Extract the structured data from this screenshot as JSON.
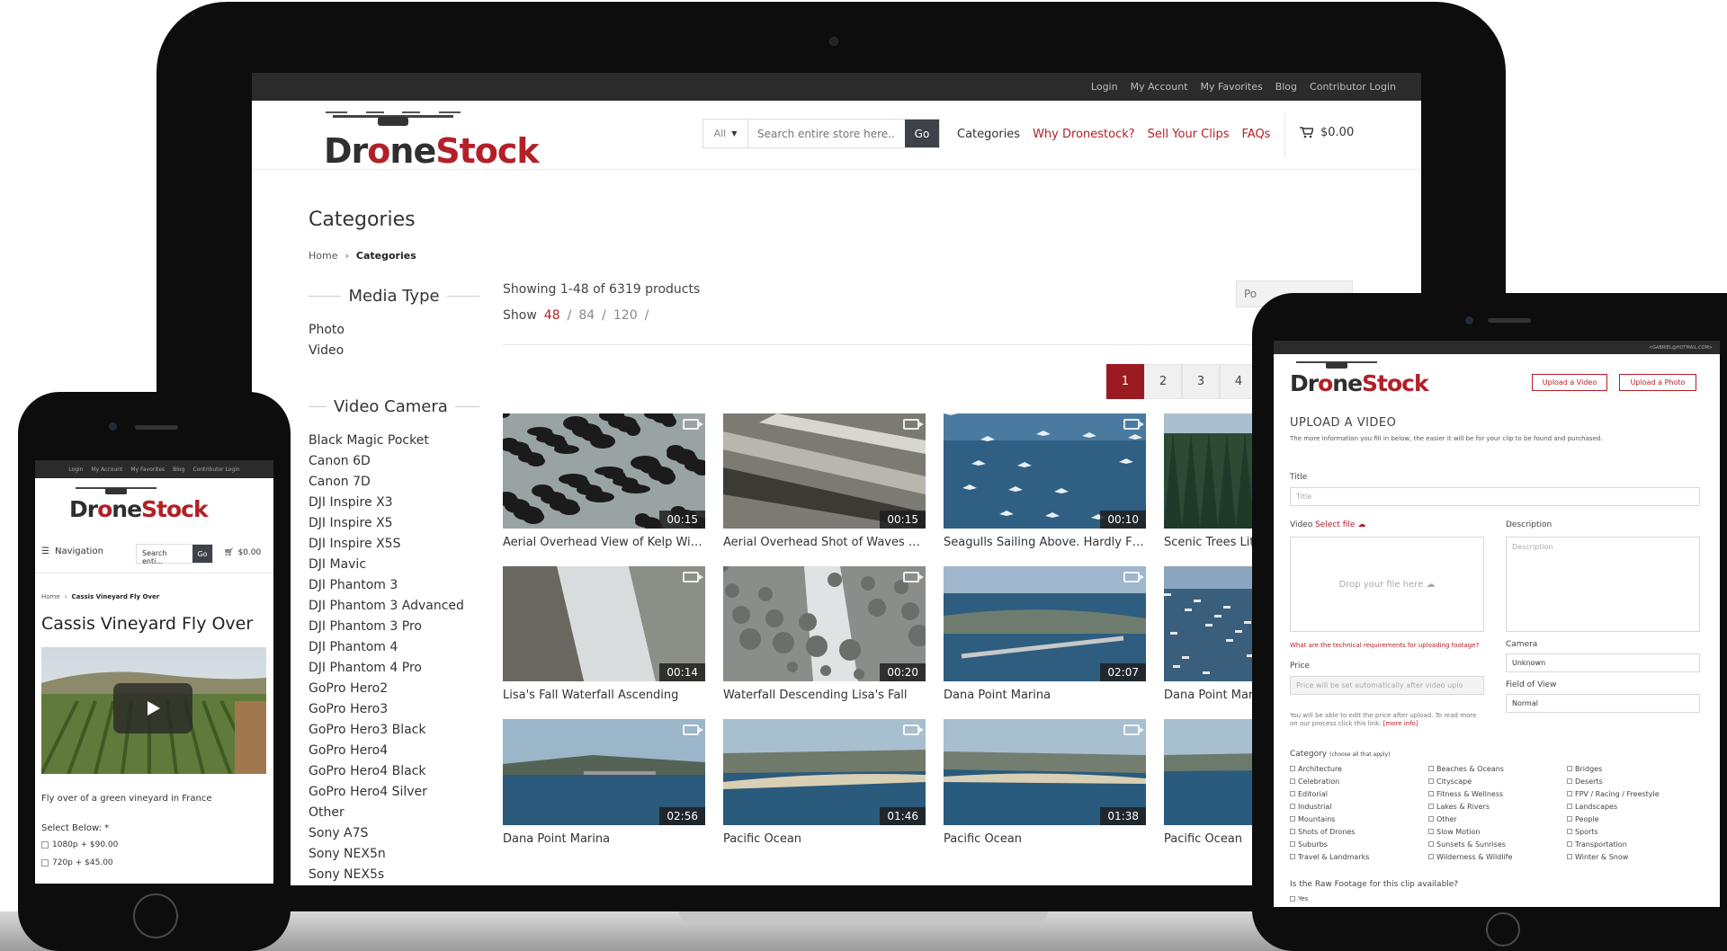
{
  "laptop": {
    "util_links": [
      "Login",
      "My Account",
      "My Favorites",
      "Blog",
      "Contributor Login"
    ],
    "logo": {
      "part1": "Dr",
      "part2": "ne",
      "part3": "Stock"
    },
    "search": {
      "category": "All",
      "placeholder": "Search entire store here...",
      "go": "Go"
    },
    "nav": [
      "Categories",
      "Why Dronestock?",
      "Sell Your Clips",
      "FAQs"
    ],
    "cart_total": "$0.00",
    "page_title": "Categories",
    "breadcrumb": {
      "home": "Home",
      "current": "Categories"
    },
    "sidebar": {
      "media_type_heading": "Media Type",
      "media_types": [
        "Photo",
        "Video"
      ],
      "camera_heading": "Video Camera",
      "cameras": [
        "Black Magic Pocket",
        "Canon 6D",
        "Canon 7D",
        "DJI Inspire X3",
        "DJI Inspire X5",
        "DJI Inspire X5S",
        "DJI Mavic",
        "DJI Phantom 3",
        "DJI Phantom 3 Advanced",
        "DJI Phantom 3 Pro",
        "DJI Phantom 4",
        "DJI Phantom 4 Pro",
        "GoPro Hero2",
        "GoPro Hero3",
        "GoPro Hero3 Black",
        "GoPro Hero4",
        "GoPro Hero4 Black",
        "GoPro Hero4 Silver",
        "Other",
        "Sony A7S",
        "Sony NEX5n",
        "Sony NEX5s"
      ]
    },
    "toolbar": {
      "count": "Showing 1-48 of 6319 products",
      "show_label": "Show",
      "show_options": [
        "48",
        "84",
        "120"
      ],
      "sort": "Po"
    },
    "pager": [
      "1",
      "2",
      "3",
      "4"
    ],
    "products": [
      {
        "title": "Aerial Overhead View of Kelp With ...",
        "duration": "00:15"
      },
      {
        "title": "Aerial Overhead Shot of Waves Rol...",
        "duration": "00:15"
      },
      {
        "title": "Seagulls Sailing Above. Hardly Fla...",
        "duration": "00:10"
      },
      {
        "title": "Scenic Trees Lit",
        "duration": ""
      },
      {
        "title": "Lisa's Fall Waterfall Ascending",
        "duration": "00:14"
      },
      {
        "title": "Waterfall Descending Lisa's Fall",
        "duration": "00:20"
      },
      {
        "title": "Dana Point Marina",
        "duration": "02:07"
      },
      {
        "title": "Dana Point Mari",
        "duration": ""
      },
      {
        "title": "Dana Point Marina",
        "duration": "02:56"
      },
      {
        "title": "Pacific Ocean",
        "duration": "01:46"
      },
      {
        "title": "Pacific Ocean",
        "duration": "01:38"
      },
      {
        "title": "Pacific Ocean",
        "duration": ""
      }
    ]
  },
  "phone": {
    "util_links": [
      "Login",
      "My Account",
      "My Favorites",
      "Blog",
      "Contributor Login"
    ],
    "nav_label": "Navigation",
    "search_placeholder": "Search enti...",
    "go": "Go",
    "cart_total": "$0.00",
    "breadcrumb": {
      "home": "Home",
      "current": "Cassis Vineyard Fly Over"
    },
    "title": "Cassis Vineyard Fly Over",
    "description": "Fly over of a green vineyard in France",
    "select_label": "Select Below: *",
    "options": [
      "1080p  + $90.00",
      "720p  + $45.00"
    ]
  },
  "tablet": {
    "email": "<GABRIEL@HOTMAIL.COM>",
    "upload_video_btn": "Upload a Video",
    "upload_photo_btn": "Upload a Photo",
    "heading": "UPLOAD A VIDEO",
    "subtext": "The more information you fill in below, the easier it will be for your clip to be found and purchased.",
    "title_label": "Title",
    "title_placeholder": "Title",
    "video_label": "Video",
    "select_file": "Select file",
    "drop_text": "Drop your file here",
    "description_label": "Description",
    "description_placeholder": "Description",
    "tech_link": "What are the technical requirements for uploading footage?",
    "camera_label": "Camera",
    "camera_value": "Unknown",
    "price_label": "Price",
    "price_placeholder": "Price will be set automatically after video uplo",
    "fov_label": "Field of View",
    "fov_value": "Normal",
    "price_note": "You will be able to edit the price after upload. To read more on our process click this link:",
    "more_info": "[more info]",
    "category_label": "Category",
    "category_hint": "(choose all that apply)",
    "categories": [
      "Architecture",
      "Beaches & Oceans",
      "Bridges",
      "Celebration",
      "Cityscape",
      "Deserts",
      "Editorial",
      "Fitness & Wellness",
      "FPV / Racing / Freestyle",
      "Industrial",
      "Lakes & Rivers",
      "Landscapes",
      "Mountains",
      "Other",
      "People",
      "Shots of Drones",
      "Slow Motion",
      "Sports",
      "Suburbs",
      "Sunsets & Sunrises",
      "Transportation",
      "Travel & Landmarks",
      "Wilderness & Wildlife",
      "Winter & Snow"
    ],
    "raw_question": "Is the Raw Footage for this clip available?",
    "yes": "Yes"
  },
  "colors": {
    "brand_red": "#b22028",
    "dark_bar": "#2b2b2b",
    "button_dark": "#3d4248"
  }
}
